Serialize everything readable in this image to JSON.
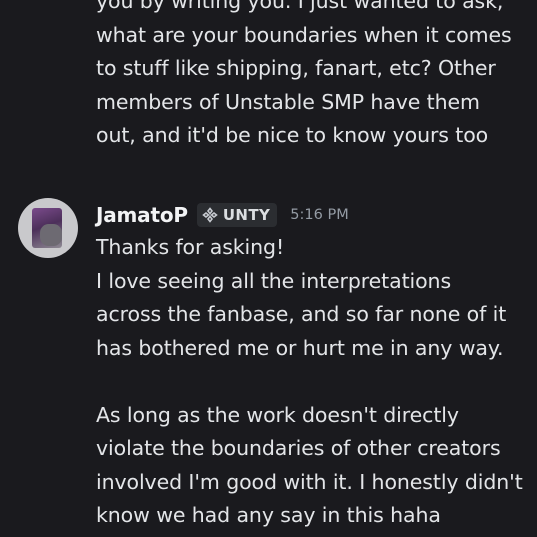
{
  "previous_message": {
    "lines": [
      "you by writing you. I just wanted to ask,",
      "what are your boundaries when it comes",
      "to stuff like shipping, fanart, etc? Other",
      "members of Unstable SMP have them",
      "out, and it'd be nice to know yours too"
    ]
  },
  "message": {
    "username": "JamatoP",
    "server_tag": "UNTY",
    "tag_icon": "diamond-plus-icon",
    "timestamp": "5:16 PM",
    "paragraph1": [
      "Thanks for asking!",
      "I love seeing all the interpretations",
      "across the fanbase, and so far none of it",
      "has bothered me or hurt me in any way."
    ],
    "paragraph2": [
      "As long as the work doesn't directly",
      "violate the boundaries of other creators",
      "involved I'm good with it. I honestly didn't",
      "know we had any say in this haha"
    ]
  },
  "colors": {
    "background": "#1a1a1e",
    "text": "#e3e5e8",
    "username": "#f2f3f5",
    "timestamp": "#949ba4",
    "tag_background": "#2b2d31"
  }
}
